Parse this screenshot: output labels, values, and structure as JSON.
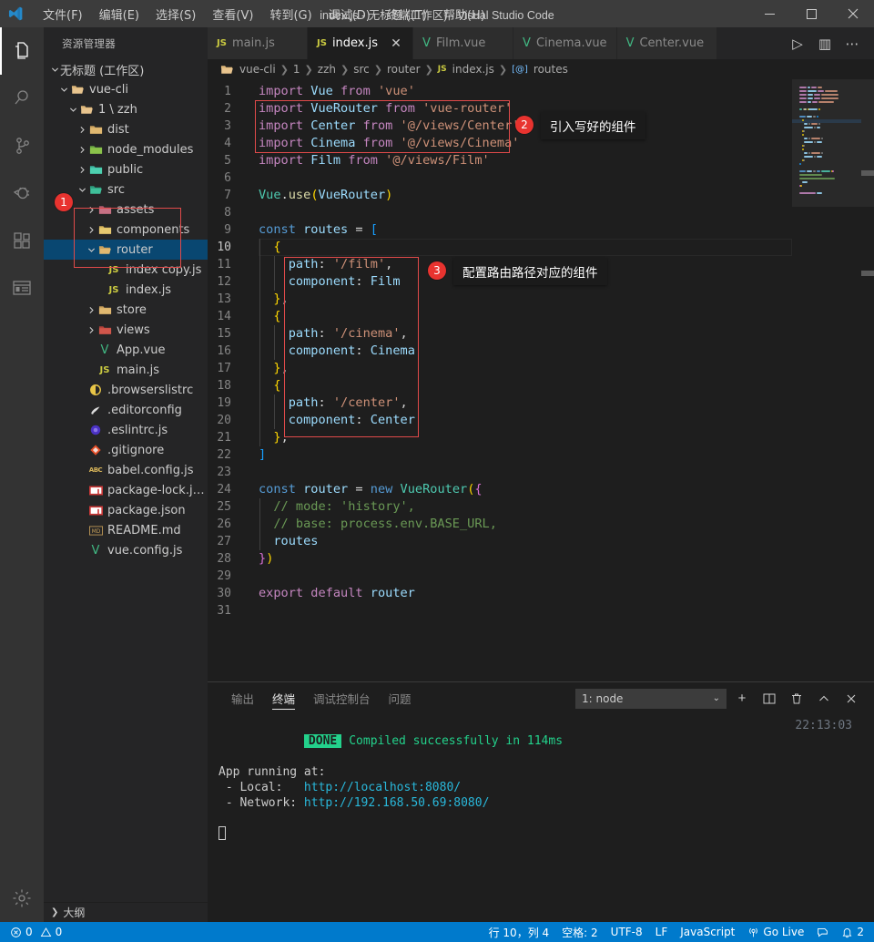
{
  "window": {
    "title": "index.js - 无标题 (工作区) - Visual Studio Code",
    "minimize": "—",
    "maximize": "▢",
    "close": "✕"
  },
  "menu": [
    {
      "label": "文件(F)",
      "name": "menu-file"
    },
    {
      "label": "编辑(E)",
      "name": "menu-edit"
    },
    {
      "label": "选择(S)",
      "name": "menu-selection"
    },
    {
      "label": "查看(V)",
      "name": "menu-view"
    },
    {
      "label": "转到(G)",
      "name": "menu-go"
    },
    {
      "label": "调试(D)",
      "name": "menu-debug"
    },
    {
      "label": "终端(T)",
      "name": "menu-terminal"
    },
    {
      "label": "帮助(H)",
      "name": "menu-help"
    }
  ],
  "activitybar": [
    {
      "icon": "explorer-icon",
      "active": true
    },
    {
      "icon": "search-icon",
      "active": false
    },
    {
      "icon": "source-control-icon",
      "active": false
    },
    {
      "icon": "debug-icon",
      "active": false
    },
    {
      "icon": "extensions-icon",
      "active": false
    },
    {
      "icon": "remote-explorer-icon",
      "active": false
    },
    {
      "icon": "settings-gear-icon",
      "active": false
    }
  ],
  "sidebar": {
    "title": "资源管理器",
    "outline_label": "大纲",
    "tree": [
      {
        "label": "无标题 (工作区)",
        "indent": 0,
        "chev": "down",
        "icon": "",
        "kind": "workspace"
      },
      {
        "label": "vue-cli",
        "indent": 1,
        "chev": "down",
        "icon": "folder-open",
        "kind": "folder"
      },
      {
        "label": "1 \\ zzh",
        "indent": 2,
        "chev": "down",
        "icon": "folder-open",
        "kind": "folder"
      },
      {
        "label": "dist",
        "indent": 3,
        "chev": "right",
        "icon": "folder-dist",
        "kind": "folder"
      },
      {
        "label": "node_modules",
        "indent": 3,
        "chev": "right",
        "icon": "folder-node",
        "kind": "folder"
      },
      {
        "label": "public",
        "indent": 3,
        "chev": "right",
        "icon": "folder-public",
        "kind": "folder"
      },
      {
        "label": "src",
        "indent": 3,
        "chev": "down",
        "icon": "folder-src",
        "kind": "folder"
      },
      {
        "label": "assets",
        "indent": 4,
        "chev": "right",
        "icon": "folder-assets",
        "kind": "folder"
      },
      {
        "label": "components",
        "indent": 4,
        "chev": "right",
        "icon": "folder-components",
        "kind": "folder"
      },
      {
        "label": "router",
        "indent": 4,
        "chev": "down",
        "icon": "folder-router",
        "kind": "folder",
        "selected": true
      },
      {
        "label": "index copy.js",
        "indent": 5,
        "chev": "none",
        "icon": "js",
        "kind": "file"
      },
      {
        "label": "index.js",
        "indent": 5,
        "chev": "none",
        "icon": "js",
        "kind": "file"
      },
      {
        "label": "store",
        "indent": 4,
        "chev": "right",
        "icon": "folder-store",
        "kind": "folder"
      },
      {
        "label": "views",
        "indent": 4,
        "chev": "right",
        "icon": "folder-views",
        "kind": "folder"
      },
      {
        "label": "App.vue",
        "indent": 4,
        "chev": "none",
        "icon": "vue",
        "kind": "file"
      },
      {
        "label": "main.js",
        "indent": 4,
        "chev": "none",
        "icon": "js",
        "kind": "file"
      },
      {
        "label": ".browserslistrc",
        "indent": 3,
        "chev": "none",
        "icon": "browserslist",
        "kind": "file"
      },
      {
        "label": ".editorconfig",
        "indent": 3,
        "chev": "none",
        "icon": "editorconfig",
        "kind": "file"
      },
      {
        "label": ".eslintrc.js",
        "indent": 3,
        "chev": "none",
        "icon": "eslint",
        "kind": "file"
      },
      {
        "label": ".gitignore",
        "indent": 3,
        "chev": "none",
        "icon": "git",
        "kind": "file"
      },
      {
        "label": "babel.config.js",
        "indent": 3,
        "chev": "none",
        "icon": "babel",
        "kind": "file"
      },
      {
        "label": "package-lock.js...",
        "indent": 3,
        "chev": "none",
        "icon": "npm",
        "kind": "file"
      },
      {
        "label": "package.json",
        "indent": 3,
        "chev": "none",
        "icon": "npm",
        "kind": "file"
      },
      {
        "label": "README.md",
        "indent": 3,
        "chev": "none",
        "icon": "md",
        "kind": "file"
      },
      {
        "label": "vue.config.js",
        "indent": 3,
        "chev": "none",
        "icon": "vue-config",
        "kind": "file"
      }
    ]
  },
  "tabs": [
    {
      "label": "main.js",
      "icon": "js-icon",
      "active": false,
      "closable": false
    },
    {
      "label": "index.js",
      "icon": "js-icon",
      "active": true,
      "closable": true
    },
    {
      "label": "Film.vue",
      "icon": "vue-icon",
      "active": false,
      "closable": false
    },
    {
      "label": "Cinema.vue",
      "icon": "vue-icon",
      "active": false,
      "closable": false
    },
    {
      "label": "Center.vue",
      "icon": "vue-icon",
      "active": false,
      "closable": false
    }
  ],
  "tab_actions": [
    {
      "name": "run-icon",
      "glyph": "▷"
    },
    {
      "name": "split-editor-icon",
      "glyph": "▥"
    },
    {
      "name": "more-actions-icon",
      "glyph": "⋯"
    }
  ],
  "breadcrumb": [
    "vue-cli",
    "1",
    "zzh",
    "src",
    "router",
    "index.js",
    "routes"
  ],
  "editor": {
    "first_line": 1,
    "current_line": 10,
    "lines": [
      {
        "n": 1,
        "tokens": [
          {
            "t": "import ",
            "c": "k-kw2"
          },
          {
            "t": "Vue",
            "c": "k-id"
          },
          {
            "t": " from ",
            "c": "k-kw2"
          },
          {
            "t": "'vue'",
            "c": "k-str"
          }
        ]
      },
      {
        "n": 2,
        "tokens": [
          {
            "t": "import ",
            "c": "k-kw2"
          },
          {
            "t": "VueRouter",
            "c": "k-id"
          },
          {
            "t": " from ",
            "c": "k-kw2"
          },
          {
            "t": "'vue-router'",
            "c": "k-str"
          }
        ]
      },
      {
        "n": 3,
        "tokens": [
          {
            "t": "import ",
            "c": "k-kw2"
          },
          {
            "t": "Center",
            "c": "k-id"
          },
          {
            "t": " from ",
            "c": "k-kw2"
          },
          {
            "t": "'@/views/Center'",
            "c": "k-str"
          }
        ]
      },
      {
        "n": 4,
        "tokens": [
          {
            "t": "import ",
            "c": "k-kw2"
          },
          {
            "t": "Cinema",
            "c": "k-id"
          },
          {
            "t": " from ",
            "c": "k-kw2"
          },
          {
            "t": "'@/views/Cinema'",
            "c": "k-str"
          }
        ]
      },
      {
        "n": 5,
        "tokens": [
          {
            "t": "import ",
            "c": "k-kw2"
          },
          {
            "t": "Film",
            "c": "k-id"
          },
          {
            "t": " from ",
            "c": "k-kw2"
          },
          {
            "t": "'@/views/Film'",
            "c": "k-str"
          }
        ]
      },
      {
        "n": 6,
        "tokens": []
      },
      {
        "n": 7,
        "tokens": [
          {
            "t": "Vue",
            "c": "k-cls"
          },
          {
            "t": ".",
            "c": "k-pl"
          },
          {
            "t": "use",
            "c": "k-fn"
          },
          {
            "t": "(",
            "c": "k-br1"
          },
          {
            "t": "VueRouter",
            "c": "k-id"
          },
          {
            "t": ")",
            "c": "k-br1"
          }
        ]
      },
      {
        "n": 8,
        "tokens": []
      },
      {
        "n": 9,
        "tokens": [
          {
            "t": "const ",
            "c": "k-kw"
          },
          {
            "t": "routes",
            "c": "k-id"
          },
          {
            "t": " = ",
            "c": "k-pl"
          },
          {
            "t": "[",
            "c": "k-br3"
          }
        ]
      },
      {
        "n": 10,
        "tokens": [
          {
            "t": "  ",
            "c": "k-pl"
          },
          {
            "t": "{",
            "c": "k-br1"
          }
        ]
      },
      {
        "n": 11,
        "tokens": [
          {
            "t": "    ",
            "c": "k-pl"
          },
          {
            "t": "path",
            "c": "k-id"
          },
          {
            "t": ": ",
            "c": "k-pl"
          },
          {
            "t": "'/film'",
            "c": "k-str"
          },
          {
            "t": ",",
            "c": "k-pl"
          }
        ]
      },
      {
        "n": 12,
        "tokens": [
          {
            "t": "    ",
            "c": "k-pl"
          },
          {
            "t": "component",
            "c": "k-id"
          },
          {
            "t": ": ",
            "c": "k-pl"
          },
          {
            "t": "Film",
            "c": "k-id"
          }
        ]
      },
      {
        "n": 13,
        "tokens": [
          {
            "t": "  ",
            "c": "k-pl"
          },
          {
            "t": "}",
            "c": "k-br1"
          },
          {
            "t": ",",
            "c": "k-pl"
          }
        ]
      },
      {
        "n": 14,
        "tokens": [
          {
            "t": "  ",
            "c": "k-pl"
          },
          {
            "t": "{",
            "c": "k-br1"
          }
        ]
      },
      {
        "n": 15,
        "tokens": [
          {
            "t": "    ",
            "c": "k-pl"
          },
          {
            "t": "path",
            "c": "k-id"
          },
          {
            "t": ": ",
            "c": "k-pl"
          },
          {
            "t": "'/cinema'",
            "c": "k-str"
          },
          {
            "t": ",",
            "c": "k-pl"
          }
        ]
      },
      {
        "n": 16,
        "tokens": [
          {
            "t": "    ",
            "c": "k-pl"
          },
          {
            "t": "component",
            "c": "k-id"
          },
          {
            "t": ": ",
            "c": "k-pl"
          },
          {
            "t": "Cinema",
            "c": "k-id"
          }
        ]
      },
      {
        "n": 17,
        "tokens": [
          {
            "t": "  ",
            "c": "k-pl"
          },
          {
            "t": "}",
            "c": "k-br1"
          },
          {
            "t": ",",
            "c": "k-pl"
          }
        ]
      },
      {
        "n": 18,
        "tokens": [
          {
            "t": "  ",
            "c": "k-pl"
          },
          {
            "t": "{",
            "c": "k-br1"
          }
        ]
      },
      {
        "n": 19,
        "tokens": [
          {
            "t": "    ",
            "c": "k-pl"
          },
          {
            "t": "path",
            "c": "k-id"
          },
          {
            "t": ": ",
            "c": "k-pl"
          },
          {
            "t": "'/center'",
            "c": "k-str"
          },
          {
            "t": ",",
            "c": "k-pl"
          }
        ]
      },
      {
        "n": 20,
        "tokens": [
          {
            "t": "    ",
            "c": "k-pl"
          },
          {
            "t": "component",
            "c": "k-id"
          },
          {
            "t": ": ",
            "c": "k-pl"
          },
          {
            "t": "Center",
            "c": "k-id"
          }
        ]
      },
      {
        "n": 21,
        "tokens": [
          {
            "t": "  ",
            "c": "k-pl"
          },
          {
            "t": "}",
            "c": "k-br1"
          },
          {
            "t": ",",
            "c": "k-pl"
          }
        ]
      },
      {
        "n": 22,
        "tokens": [
          {
            "t": "]",
            "c": "k-br3"
          }
        ]
      },
      {
        "n": 23,
        "tokens": []
      },
      {
        "n": 24,
        "tokens": [
          {
            "t": "const ",
            "c": "k-kw"
          },
          {
            "t": "router",
            "c": "k-id"
          },
          {
            "t": " = ",
            "c": "k-pl"
          },
          {
            "t": "new ",
            "c": "k-kw"
          },
          {
            "t": "VueRouter",
            "c": "k-cls"
          },
          {
            "t": "(",
            "c": "k-br1"
          },
          {
            "t": "{",
            "c": "k-br2"
          }
        ]
      },
      {
        "n": 25,
        "tokens": [
          {
            "t": "  // mode: 'history',",
            "c": "k-com"
          }
        ]
      },
      {
        "n": 26,
        "tokens": [
          {
            "t": "  // base: process.env.BASE_URL,",
            "c": "k-com"
          }
        ]
      },
      {
        "n": 27,
        "tokens": [
          {
            "t": "  ",
            "c": "k-pl"
          },
          {
            "t": "routes",
            "c": "k-id"
          }
        ]
      },
      {
        "n": 28,
        "tokens": [
          {
            "t": "}",
            "c": "k-br2"
          },
          {
            "t": ")",
            "c": "k-br1"
          }
        ]
      },
      {
        "n": 29,
        "tokens": []
      },
      {
        "n": 30,
        "tokens": [
          {
            "t": "export default ",
            "c": "k-kw2"
          },
          {
            "t": "router",
            "c": "k-id"
          }
        ]
      },
      {
        "n": 31,
        "tokens": []
      }
    ]
  },
  "annotations": [
    {
      "badge": "1",
      "label": "",
      "name": "annotation-1"
    },
    {
      "badge": "2",
      "label": "引入写好的组件",
      "name": "annotation-2"
    },
    {
      "badge": "3",
      "label": "配置路由路径对应的组件",
      "name": "annotation-3"
    }
  ],
  "panel": {
    "tabs": [
      {
        "label": "输出",
        "active": false
      },
      {
        "label": "终端",
        "active": true
      },
      {
        "label": "调试控制台",
        "active": false
      },
      {
        "label": "问题",
        "active": false
      }
    ],
    "terminal_select": "1: node",
    "actions": [
      {
        "name": "new-terminal-icon",
        "glyph": "+"
      },
      {
        "name": "split-terminal-icon",
        "glyph": "▥"
      },
      {
        "name": "kill-terminal-icon",
        "glyph": "🗑"
      },
      {
        "name": "maximize-panel-icon",
        "glyph": "⌃"
      },
      {
        "name": "close-panel-icon",
        "glyph": "✕"
      }
    ],
    "terminal": {
      "done_badge": "DONE",
      "compiled_message": "Compiled successfully in 114ms",
      "timestamp": "22:13:03",
      "running_at": "App running at:",
      "local_label": " - Local:   ",
      "local_url": "http://localhost:8080/",
      "network_label": " - Network: ",
      "network_url": "http://192.168.50.69:8080/"
    }
  },
  "statusbar": {
    "errors": "0",
    "warnings": "0",
    "position": "行 10，列 4",
    "spaces": "空格: 2",
    "encoding": "UTF-8",
    "eol": "LF",
    "language": "JavaScript",
    "golive": "Go Live",
    "notifications": "2",
    "bg": "#007acc"
  }
}
